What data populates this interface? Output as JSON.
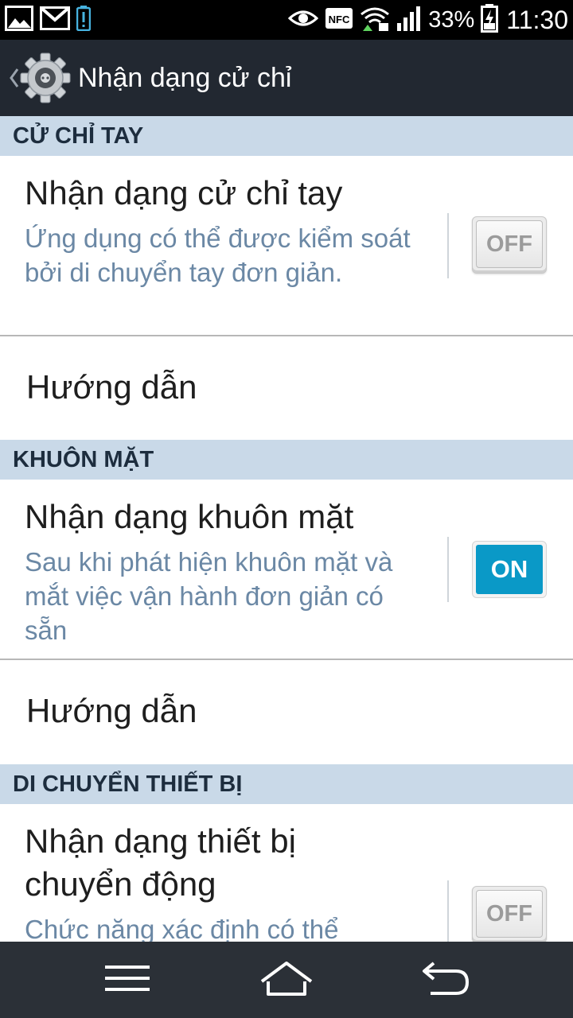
{
  "status_bar": {
    "battery_percent": "33%",
    "time": "11:30",
    "nfc_label": "NFC",
    "left_icons": [
      "gallery-icon",
      "gmail-icon",
      "battery-alert-icon"
    ],
    "right_icons": [
      "eye-icon",
      "nfc-icon",
      "wifi-icon",
      "signal-icon",
      "battery-charging-icon"
    ]
  },
  "action_bar": {
    "title": "Nhận dạng cử chỉ",
    "icon": "gear-icon"
  },
  "sections": [
    {
      "header": "CỬ CHỈ TAY",
      "items": [
        {
          "title": "Nhận dạng cử chỉ tay",
          "summary": "Ứng dụng có thể được kiểm soát bởi di chuyển tay đơn giản.",
          "toggle": "OFF"
        },
        {
          "title": "Hướng dẫn"
        }
      ]
    },
    {
      "header": "KHUÔN MẶT",
      "items": [
        {
          "title": "Nhận dạng khuôn mặt",
          "summary": "Sau khi phát hiện khuôn mặt và mắt việc vận hành đơn giản có sẵn",
          "toggle": "ON"
        },
        {
          "title": "Hướng dẫn"
        }
      ]
    },
    {
      "header": "DI CHUYỂN THIẾT BỊ",
      "items": [
        {
          "title_line1": "Nhận dạng thiết bị",
          "title_line2": "chuyển động",
          "summary": "Chức năng xác định có thể",
          "toggle": "OFF"
        }
      ]
    }
  ],
  "nav_bar": {
    "icons": [
      "menu-icon",
      "home-icon",
      "back-icon"
    ]
  },
  "colors": {
    "accent_on": "#0a99c7",
    "section_header_bg": "#c9d9e8",
    "summary_text": "#6b88a5",
    "action_bar_bg": "#222831"
  }
}
